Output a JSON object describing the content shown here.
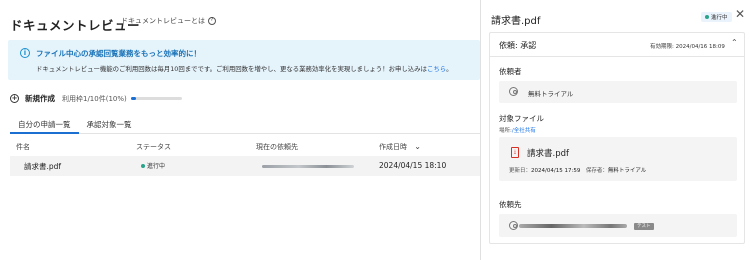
{
  "header": {
    "title": "ドキュメントレビュー",
    "about_link": "ドキュメントレビューとは",
    "help_icon": "question-circle-icon"
  },
  "banner": {
    "icon": "info-icon",
    "title": "ファイル中心の承認回覧業務をもっと効率的に！",
    "text": "ドキュメントレビュー機能のご利用回数は毎月10回までです。ご利用回数を増やし、更なる業務効率化を実現しましょう！お申し込みは",
    "link": "こちら",
    "suffix": "。"
  },
  "create": {
    "icon": "plus-circle-icon",
    "label": "新規作成",
    "usage": "利用枠1/10件(10%)",
    "usage_progress": 0.1
  },
  "tabs": [
    {
      "label": "自分の申請一覧",
      "active": true
    },
    {
      "label": "承認対象一覧",
      "active": false
    }
  ],
  "table": {
    "columns": [
      "件名",
      "ステータス",
      "現在の依頼先",
      "作成日時"
    ],
    "sort_icon": "chevron-down-icon",
    "rows": [
      {
        "subject": "請求書.pdf",
        "status": "進行中",
        "assignee": "",
        "created": "2024/04/15 18:10"
      }
    ]
  },
  "panel": {
    "title": "請求書.pdf",
    "status": "進行中",
    "status_color": "#2aa38b",
    "close_icon": "close-icon",
    "request": {
      "title": "依頼: 承認",
      "expiry_label": "有効期限:",
      "expiry_value": "2024/04/16 18:09",
      "collapse_icon": "chevron-up-icon"
    },
    "requester": {
      "label": "依頼者",
      "name": "無料トライアル"
    },
    "target": {
      "label": "対象ファイル",
      "location_label": "場所:",
      "location": "/全社共有",
      "file_name": "請求書.pdf",
      "updated_label": "更新日：",
      "updated": "2024/04/15 17:59",
      "saved_by_label": "保存者：",
      "saved_by": "無料トライアル"
    },
    "assignee": {
      "label": "依頼先",
      "tag": "テスト"
    }
  },
  "colors": {
    "accent": "#1a6fd1",
    "banner_bg": "#e5f3fb"
  }
}
